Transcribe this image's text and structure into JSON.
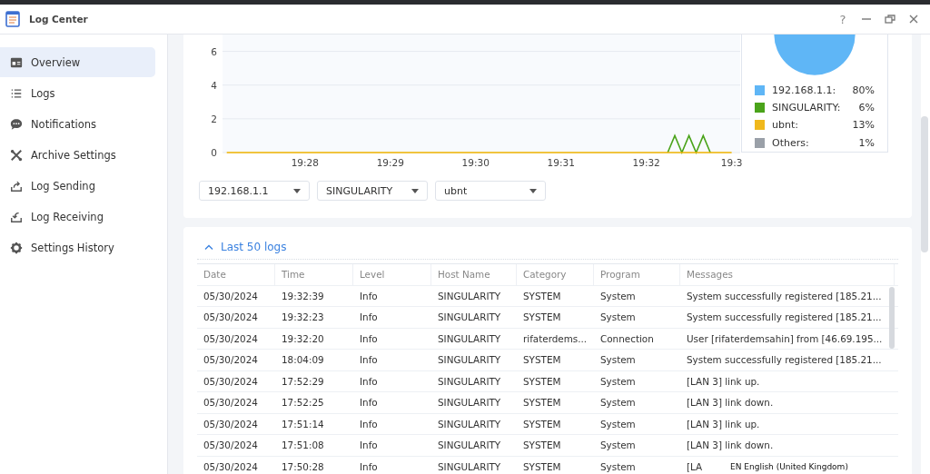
{
  "window": {
    "title": "Log Center",
    "controls": [
      "?"
    ]
  },
  "sidebar": {
    "items": [
      {
        "label": "Overview",
        "selected": true
      },
      {
        "label": "Logs",
        "selected": false
      },
      {
        "label": "Notifications",
        "selected": false
      },
      {
        "label": "Archive Settings",
        "selected": false
      },
      {
        "label": "Log Sending",
        "selected": false
      },
      {
        "label": "Log Receiving",
        "selected": false
      },
      {
        "label": "Settings History",
        "selected": false
      }
    ]
  },
  "overview": {
    "line_chart": {
      "chart_data": {
        "type": "line",
        "ylim": [
          0,
          7
        ],
        "yticks": [
          0,
          2,
          4,
          6
        ],
        "grid": true,
        "categories": [
          null,
          null,
          null,
          null,
          null,
          null,
          null,
          null,
          null,
          null,
          null,
          "19:28",
          null,
          null,
          null,
          null,
          null,
          null,
          null,
          null,
          null,
          null,
          null,
          "19:29",
          null,
          null,
          null,
          null,
          null,
          null,
          null,
          null,
          null,
          null,
          null,
          "19:30",
          null,
          null,
          null,
          null,
          null,
          null,
          null,
          null,
          null,
          null,
          null,
          "19:31",
          null,
          null,
          null,
          null,
          null,
          null,
          null,
          null,
          null,
          null,
          null,
          "19:32",
          null,
          null,
          null,
          null,
          null,
          null,
          null,
          null,
          null,
          null,
          null,
          "19:3"
        ],
        "series": [
          {
            "color": "#4aa31a",
            "values": [
              null,
              null,
              null,
              null,
              null,
              null,
              null,
              null,
              null,
              null,
              null,
              null,
              null,
              null,
              null,
              null,
              null,
              null,
              null,
              null,
              null,
              null,
              null,
              null,
              null,
              null,
              null,
              null,
              null,
              null,
              null,
              null,
              null,
              null,
              null,
              null,
              null,
              null,
              null,
              null,
              null,
              null,
              null,
              null,
              null,
              null,
              null,
              null,
              null,
              null,
              null,
              null,
              null,
              null,
              null,
              null,
              null,
              null,
              null,
              null,
              null,
              null,
              0,
              1,
              0,
              1,
              0,
              1,
              0,
              null,
              null,
              null
            ]
          },
          {
            "color": "#f0b400",
            "values": [
              0,
              0,
              0,
              0,
              0,
              0,
              0,
              0,
              0,
              0,
              0,
              0,
              0,
              0,
              0,
              0,
              0,
              0,
              0,
              0,
              0,
              0,
              0,
              0,
              0,
              0,
              0,
              0,
              0,
              0,
              0,
              0,
              0,
              0,
              0,
              0,
              0,
              0,
              0,
              0,
              0,
              0,
              0,
              0,
              0,
              0,
              0,
              0,
              0,
              0,
              0,
              0,
              0,
              0,
              0,
              0,
              0,
              0,
              0,
              0,
              0,
              0,
              0,
              0,
              0,
              0,
              0,
              0,
              0,
              0,
              0,
              0
            ]
          }
        ]
      }
    },
    "filters": [
      {
        "value": "192.168.1.1"
      },
      {
        "value": "SINGULARITY"
      },
      {
        "value": "ubnt"
      }
    ],
    "legend": [
      {
        "label": "192.168.1.1:",
        "percent": "80%",
        "color": "#5fb6f6"
      },
      {
        "label": "SINGULARITY:",
        "percent": "6%",
        "color": "#4aa31a"
      },
      {
        "label": "ubnt:",
        "percent": "13%",
        "color": "#f0b81c"
      },
      {
        "label": "Others:",
        "percent": "1%",
        "color": "#9aa0a8"
      }
    ]
  },
  "logs": {
    "title": "Last 50 logs",
    "expanded": true,
    "columns": [
      "Date",
      "Time",
      "Level",
      "Host Name",
      "Category",
      "Program",
      "Messages"
    ],
    "rows": [
      [
        "05/30/2024",
        "19:32:39",
        "Info",
        "SINGULARITY",
        "SYSTEM",
        "System",
        "System successfully registered [185.21..."
      ],
      [
        "05/30/2024",
        "19:32:23",
        "Info",
        "SINGULARITY",
        "SYSTEM",
        "System",
        "System successfully registered [185.21..."
      ],
      [
        "05/30/2024",
        "19:32:20",
        "Info",
        "SINGULARITY",
        "rifaterdems...",
        "Connection",
        "User [rifaterdemsahin] from [46.69.195..."
      ],
      [
        "05/30/2024",
        "18:04:09",
        "Info",
        "SINGULARITY",
        "SYSTEM",
        "System",
        "System successfully registered [185.21..."
      ],
      [
        "05/30/2024",
        "17:52:29",
        "Info",
        "SINGULARITY",
        "SYSTEM",
        "System",
        "[LAN 3] link up."
      ],
      [
        "05/30/2024",
        "17:52:25",
        "Info",
        "SINGULARITY",
        "SYSTEM",
        "System",
        "[LAN 3] link down."
      ],
      [
        "05/30/2024",
        "17:51:14",
        "Info",
        "SINGULARITY",
        "SYSTEM",
        "System",
        "[LAN 3] link up."
      ],
      [
        "05/30/2024",
        "17:51:08",
        "Info",
        "SINGULARITY",
        "SYSTEM",
        "System",
        "[LAN 3] link down."
      ],
      [
        "05/30/2024",
        "17:50:28",
        "Info",
        "SINGULARITY",
        "SYSTEM",
        "System",
        "[LA"
      ]
    ]
  },
  "language_popup": {
    "text": "EN English (United Kingdom)"
  }
}
